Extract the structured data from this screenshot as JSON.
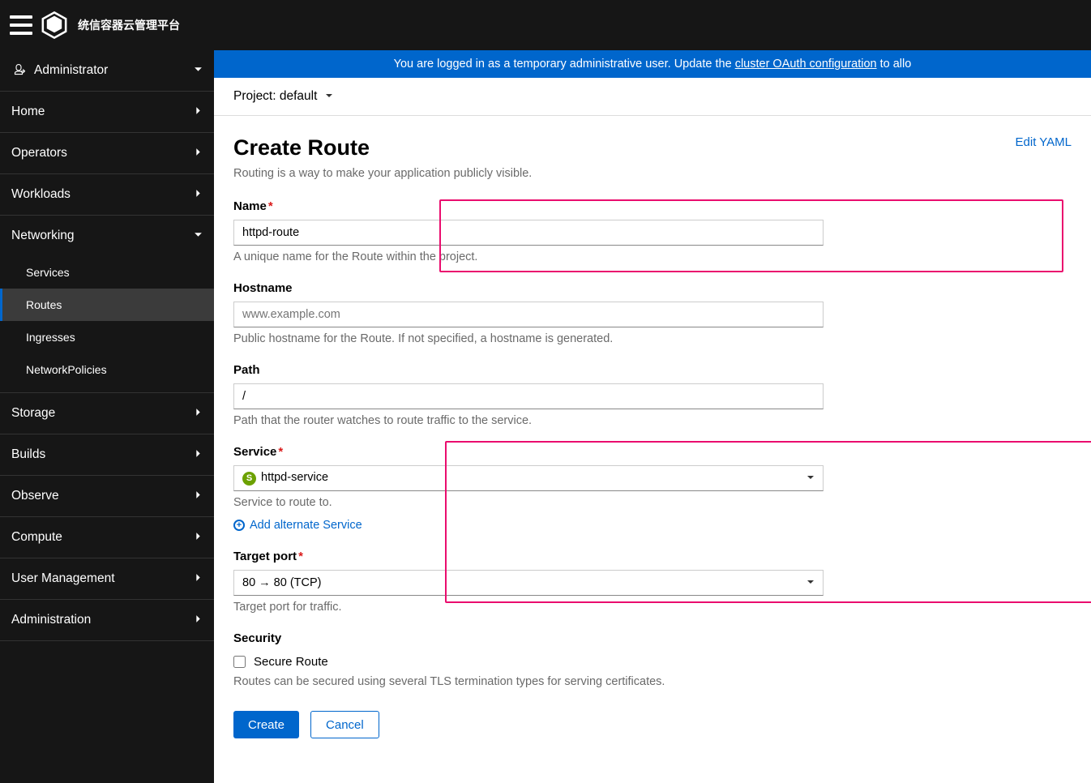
{
  "header": {
    "logo_text": "统信容器云管理平台"
  },
  "sidebar": {
    "perspective": "Administrator",
    "items": [
      {
        "label": "Home",
        "expanded": false
      },
      {
        "label": "Operators",
        "expanded": false
      },
      {
        "label": "Workloads",
        "expanded": false
      },
      {
        "label": "Networking",
        "expanded": true,
        "children": [
          "Services",
          "Routes",
          "Ingresses",
          "NetworkPolicies"
        ],
        "activeChild": 1
      },
      {
        "label": "Storage",
        "expanded": false
      },
      {
        "label": "Builds",
        "expanded": false
      },
      {
        "label": "Observe",
        "expanded": false
      },
      {
        "label": "Compute",
        "expanded": false
      },
      {
        "label": "User Management",
        "expanded": false
      },
      {
        "label": "Administration",
        "expanded": false
      }
    ]
  },
  "notice": {
    "prefix": "You are logged in as a temporary administrative user. Update the ",
    "link": "cluster OAuth configuration",
    "suffix": " to allo"
  },
  "project_bar": {
    "label": "Project:",
    "value": "default"
  },
  "page": {
    "title": "Create Route",
    "edit_yaml": "Edit YAML",
    "desc": "Routing is a way to make your application publicly visible."
  },
  "form": {
    "name": {
      "label": "Name",
      "value": "httpd-route",
      "help": "A unique name for the Route within the project."
    },
    "hostname": {
      "label": "Hostname",
      "placeholder": "www.example.com",
      "help": "Public hostname for the Route. If not specified, a hostname is generated."
    },
    "path": {
      "label": "Path",
      "value": "/",
      "help": "Path that the router watches to route traffic to the service."
    },
    "service": {
      "label": "Service",
      "value": "httpd-service",
      "help": "Service to route to.",
      "badge": "S"
    },
    "add_alt": "Add alternate Service",
    "target_port": {
      "label": "Target port",
      "value": "80 → 80 (TCP)",
      "help": "Target port for traffic."
    },
    "security": {
      "label": "Security",
      "checkbox_label": "Secure Route",
      "help": "Routes can be secured using several TLS termination types for serving certificates."
    }
  },
  "buttons": {
    "create": "Create",
    "cancel": "Cancel"
  }
}
